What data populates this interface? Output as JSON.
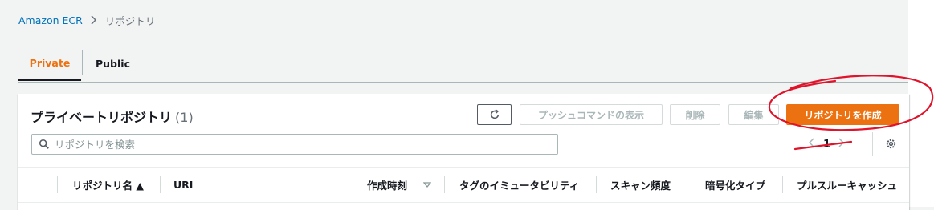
{
  "breadcrumb": {
    "root": "Amazon ECR",
    "current": "リポジトリ"
  },
  "tabs": [
    {
      "label": "Private",
      "active": true
    },
    {
      "label": "Public",
      "active": false
    }
  ],
  "panel": {
    "title": "プライベートリポジトリ",
    "count": "(1)",
    "buttons": {
      "push_commands": "プッシュコマンドの表示",
      "delete": "削除",
      "edit": "編集",
      "create": "リポジトリを作成"
    },
    "search": {
      "placeholder": "リポジトリを検索"
    },
    "pagination": {
      "page": "1",
      "prev_icon": "chevron-left",
      "next_icon": "chevron-right"
    }
  },
  "table": {
    "columns": [
      {
        "label": "リポジトリ名 ▲",
        "sorted": "ascending"
      },
      {
        "label": "URI"
      },
      {
        "label": "作成時刻",
        "sortable": true
      },
      {
        "label": "タグのイミュータビリティ"
      },
      {
        "label": "スキャン頻度"
      },
      {
        "label": "暗号化タイプ"
      },
      {
        "label": "プルスルーキャッシュ"
      }
    ]
  },
  "colors": {
    "accent": "#ec7211",
    "link": "#0073bb",
    "annotation": "#e0132b"
  }
}
